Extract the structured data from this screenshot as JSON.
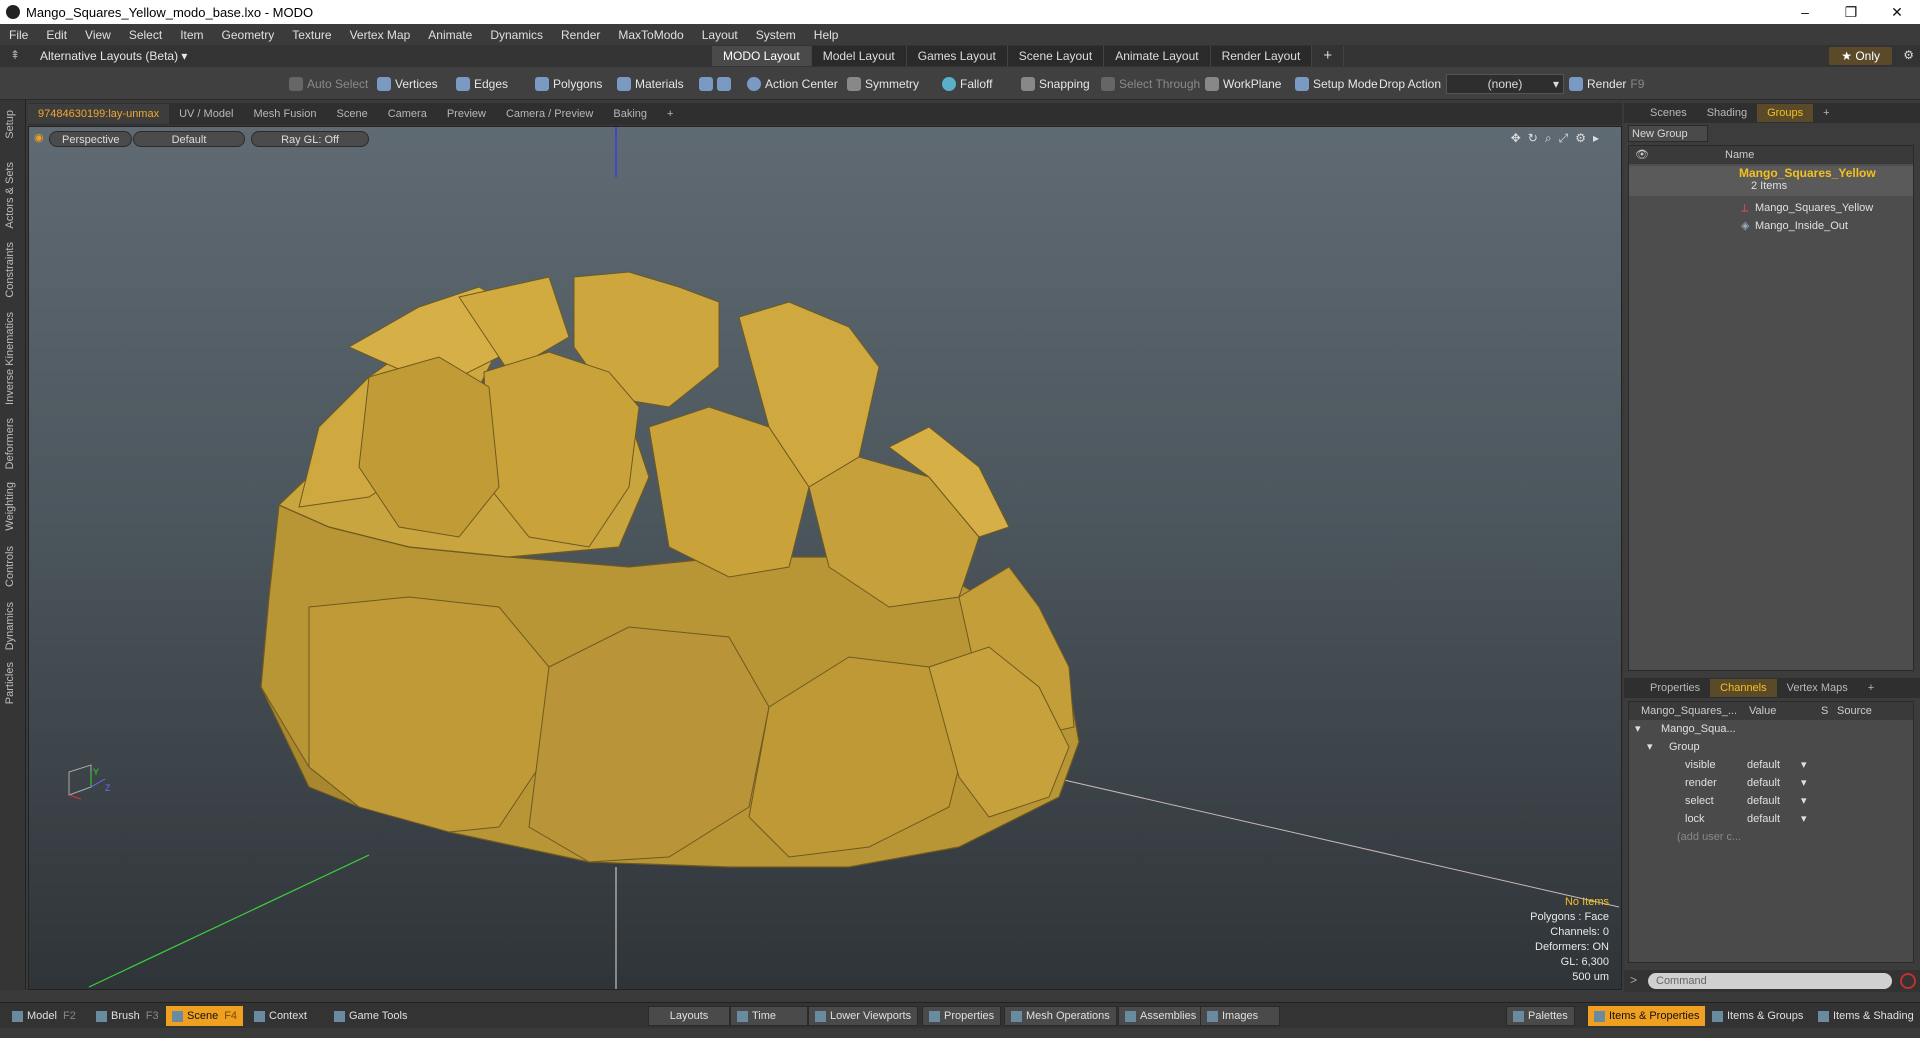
{
  "window": {
    "title": "Mango_Squares_Yellow_modo_base.lxo - MODO",
    "minimize": "–",
    "maximize": "❐",
    "close": "✕"
  },
  "menu": [
    "File",
    "Edit",
    "View",
    "Select",
    "Item",
    "Geometry",
    "Texture",
    "Vertex Map",
    "Animate",
    "Dynamics",
    "Render",
    "MaxToModo",
    "Layout",
    "System",
    "Help"
  ],
  "layoutbar": {
    "alternative": "Alternative Layouts (Beta) ▾",
    "tabs": [
      "MODO Layout",
      "Model Layout",
      "Games Layout",
      "Scene Layout",
      "Animate Layout",
      "Render Layout"
    ],
    "add": "+",
    "only": "★  Only"
  },
  "toolbar": {
    "auto_select": "Auto Select",
    "vertices": "Vertices",
    "edges": "Edges",
    "polygons": "Polygons",
    "materials": "Materials",
    "action_center": "Action Center",
    "symmetry": "Symmetry",
    "falloff": "Falloff",
    "snapping": "Snapping",
    "select_through": "Select Through",
    "workplane": "WorkPlane",
    "setup_mode": "Setup Mode",
    "drop_action": "Drop Action",
    "drop_value": "(none)",
    "render": "Render",
    "render_key": "F9"
  },
  "left_tabs": [
    "Setup",
    "Actors & Sets",
    "Constraints",
    "Inverse Kinematics",
    "Deformers",
    "Weighting",
    "Controls",
    "Dynamics",
    "Particles"
  ],
  "viewport_tabs": [
    "97484630199:lay-unmax",
    "UV / Model",
    "Mesh Fusion",
    "Scene",
    "Camera",
    "Preview",
    "Camera / Preview",
    "Baking",
    "+"
  ],
  "viewport": {
    "perspective": "Perspective",
    "default": "Default",
    "raygl": "Ray GL: Off",
    "info": {
      "no_items": "No Items",
      "polygons": "Polygons : Face",
      "channels": "Channels: 0",
      "deformers": "Deformers: ON",
      "gl": "GL: 6,300",
      "units": "500 um"
    },
    "colors": {
      "mango": "#c9a23a",
      "mango_edge": "#8a6e1c"
    }
  },
  "right_top_tabs": [
    "Scenes",
    "Shading",
    "Groups",
    "+"
  ],
  "groups": {
    "new_group": "New Group",
    "name_header": "Name",
    "root": "Mango_Squares_Yellow",
    "root_count": "2 Items",
    "children": [
      "Mango_Squares_Yellow",
      "Mango_Inside_Out"
    ]
  },
  "right_bottom_tabs": [
    "Properties",
    "Channels",
    "Vertex Maps",
    "+"
  ],
  "channels": {
    "col_item": "Mango_Squares_...",
    "col_value": "Value",
    "col_s": "S",
    "col_source": "Source",
    "root": "Mango_Squa...",
    "group": "Group",
    "rows": [
      {
        "name": "visible",
        "value": "default"
      },
      {
        "name": "render",
        "value": "default"
      },
      {
        "name": "select",
        "value": "default"
      },
      {
        "name": "lock",
        "value": "default"
      }
    ],
    "add_user": "(add user c..."
  },
  "command": {
    "prompt": ">",
    "placeholder": "Command"
  },
  "bottombar": {
    "model": "Model",
    "model_key": "F2",
    "brush": "Brush",
    "brush_key": "F3",
    "scene": "Scene",
    "scene_key": "F4",
    "context": "Context",
    "game_tools": "Game Tools",
    "layouts": "Layouts",
    "time": "Time",
    "lower_viewports": "Lower Viewports",
    "properties": "Properties",
    "mesh_operations": "Mesh Operations",
    "assemblies": "Assemblies",
    "images": "Images",
    "palettes": "Palettes",
    "items_properties": "Items & Properties",
    "items_groups": "Items & Groups",
    "items_shading": "Items & Shading"
  }
}
